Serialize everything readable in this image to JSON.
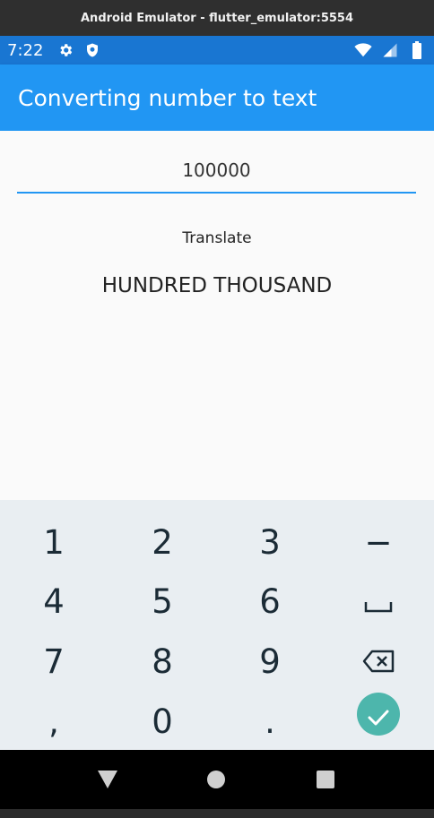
{
  "window": {
    "title": "Android Emulator - flutter_emulator:5554"
  },
  "status_bar": {
    "time": "7:22",
    "left_icons": [
      "settings-gear-icon",
      "shield-icon"
    ],
    "right_icons": [
      "wifi-icon",
      "cell-signal-icon",
      "battery-icon"
    ],
    "background": "#1976d2"
  },
  "app_bar": {
    "title": "Converting number to text",
    "background": "#2196f3"
  },
  "form": {
    "input_value": "100000",
    "button_label": "Translate",
    "result": "HUNDRED THOUSAND",
    "underline_color": "#2196f3"
  },
  "keyboard": {
    "rows": [
      [
        "1",
        "2",
        "3",
        "−"
      ],
      [
        "4",
        "5",
        "6",
        "space-icon"
      ],
      [
        "7",
        "8",
        "9",
        "backspace-icon"
      ],
      [
        ",",
        "0",
        ".",
        "done-check-icon"
      ]
    ],
    "labels": {
      "k1": "1",
      "k2": "2",
      "k3": "3",
      "minus": "−",
      "k4": "4",
      "k5": "5",
      "k6": "6",
      "k7": "7",
      "k8": "8",
      "k9": "9",
      "comma": ",",
      "k0": "0",
      "period": "."
    },
    "done_color": "#4db6ac",
    "background": "#e9eef2"
  },
  "nav_bar": {
    "icons": [
      "back-triangle-icon",
      "home-circle-icon",
      "recents-square-icon"
    ]
  }
}
